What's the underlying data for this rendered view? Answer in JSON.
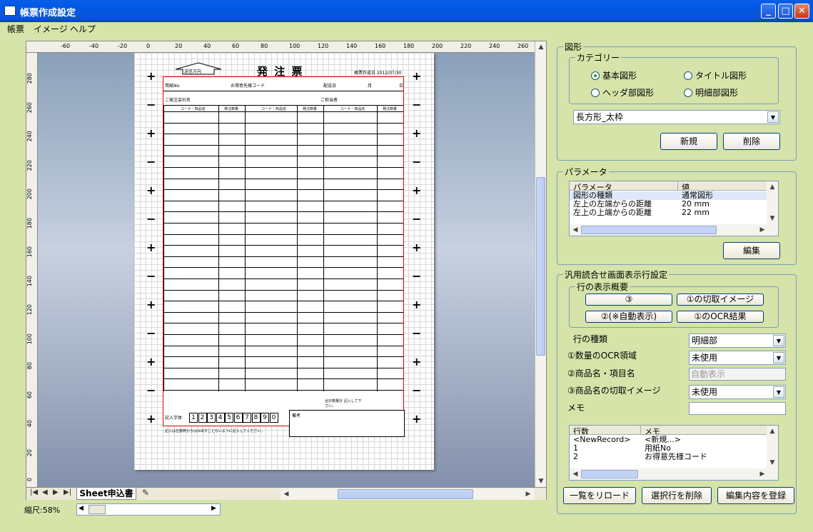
{
  "window": {
    "title": "帳票作成設定"
  },
  "menu": [
    "帳票",
    "イメージ",
    "ヘルプ"
  ],
  "ruler": {
    "h": [
      "-60",
      "-40",
      "-20",
      "0",
      "20",
      "40",
      "60",
      "80",
      "100",
      "120",
      "140",
      "160",
      "180",
      "200",
      "220",
      "240",
      "260"
    ],
    "v": [
      "280",
      "260",
      "240",
      "220",
      "200",
      "180",
      "160",
      "140",
      "120",
      "100",
      "80",
      "60",
      "40",
      "20",
      "0"
    ]
  },
  "form": {
    "title": "発 注 票",
    "direction": "送信方向",
    "created": "帳票作成日 2012/07/30",
    "slip_no": "用紙No.",
    "customer_code": "お得意先様コード",
    "delivery": "配送日",
    "month": "月",
    "day": "日",
    "company": "ご発注会社名",
    "contact": "ご担当者",
    "col_code": "コード・商品名",
    "col_qty": "発注数量",
    "total": "合計数量計 記入して下さい。",
    "sample": "記入字体",
    "digits": [
      "1",
      "2",
      "3",
      "4",
      "5",
      "6",
      "7",
      "8",
      "9",
      "0"
    ],
    "remarks": "備考",
    "note": "記入は左揃枠からはみ出すことないように記入してください。"
  },
  "sheet_tab": "Sheet申込書",
  "zoom": "縮尺:58%",
  "shape": {
    "legend": "図形",
    "category_legend": "カテゴリー",
    "radios": [
      {
        "label": "基本図形",
        "checked": true
      },
      {
        "label": "タイトル図形",
        "checked": false
      },
      {
        "label": "ヘッダ部図形",
        "checked": false
      },
      {
        "label": "明細部図形",
        "checked": false
      }
    ],
    "selected": "長方形_太枠",
    "new_label": "新規",
    "delete_label": "削除"
  },
  "params": {
    "legend": "パラメータ",
    "headers": [
      "パラメータ",
      "値"
    ],
    "rows": [
      [
        "図形の種類",
        "通常図形"
      ],
      [
        "左上の左端からの距離",
        "20 mm"
      ],
      [
        "左上の上端からの距離",
        "22 mm"
      ]
    ],
    "edit_label": "編集"
  },
  "general": {
    "legend": "汎用読合せ画面表示行設定",
    "overview_legend": "行の表示概要",
    "btn1": "③",
    "btn2": "①の切取イメージ",
    "btn3": "②(※自動表示)",
    "btn4": "①のOCR結果",
    "row_type_label": "行の種類",
    "row_type": "明細部",
    "ocr_label": "①数量のOCR領域",
    "ocr": "未使用",
    "item_label": "②商品名・項目名",
    "item": "自動表示",
    "cut_label": "③商品名の切取イメージ",
    "cut": "未使用",
    "memo_label": "メモ",
    "memo": "",
    "list_headers": [
      "行数",
      "メモ"
    ],
    "list_rows": [
      [
        "<NewRecord>",
        "<新規...>"
      ],
      [
        "1",
        "用紙No"
      ],
      [
        "2",
        "お得意先様コード"
      ]
    ],
    "reload_label": "一覧をリロード",
    "delrow_label": "選択行を削除",
    "save_label": "編集内容を登録"
  }
}
